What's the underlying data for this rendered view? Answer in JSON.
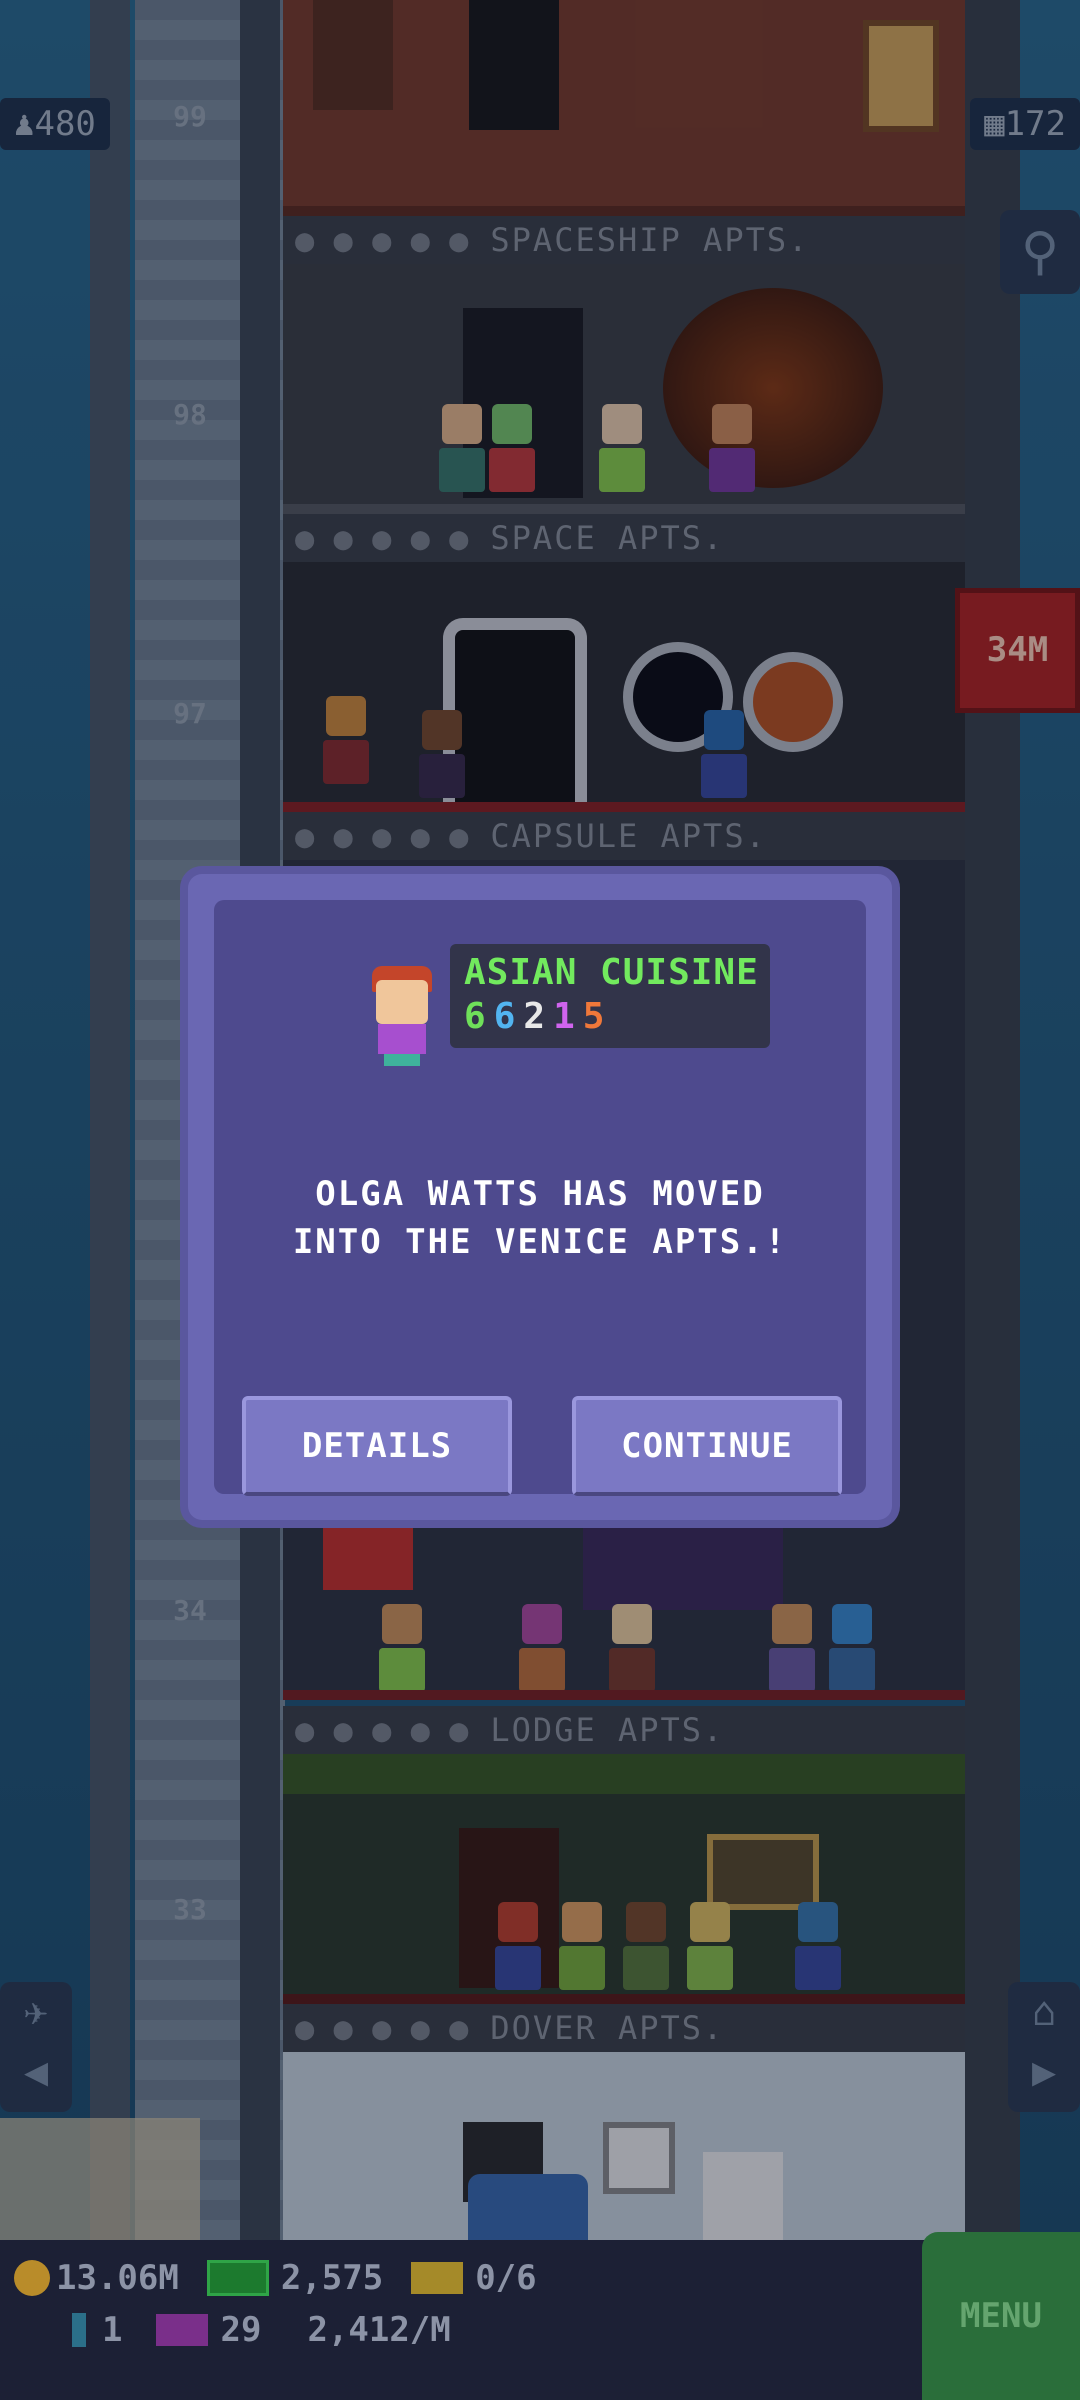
{
  "top_bar": {
    "population": "480",
    "floors": "172"
  },
  "floor_numbers": [
    "99",
    "98",
    "97",
    "34",
    "33"
  ],
  "floor_labels": {
    "spaceship": "SPACESHIP APTS.",
    "space": "SPACE APTS.",
    "capsule": "CAPSULE APTS.",
    "lodge": "LODGE APTS.",
    "dover": "DOVER APTS."
  },
  "money_badge": "34M",
  "dialog": {
    "cuisine": "ASIAN CUISINE",
    "stats": [
      "6",
      "6",
      "2",
      "1",
      "5"
    ],
    "stat_colors": [
      "#6fe05a",
      "#52b4f0",
      "#e8e8e8",
      "#d064ee",
      "#f0783a"
    ],
    "message_line1": "OLGA WATTS HAS MOVED",
    "message_line2": "INTO THE VENICE APTS.!",
    "details_label": "DETAILS",
    "continue_label": "CONTINUE"
  },
  "hud": {
    "coins": "13.06M",
    "bux": "2,575",
    "tickets": "0/6",
    "keys": "1",
    "tv": "29",
    "income": "2,412/M",
    "menu_label": "MENU"
  },
  "icons": {
    "search": "magnifier-icon",
    "lift": "elevator-down-icon"
  }
}
